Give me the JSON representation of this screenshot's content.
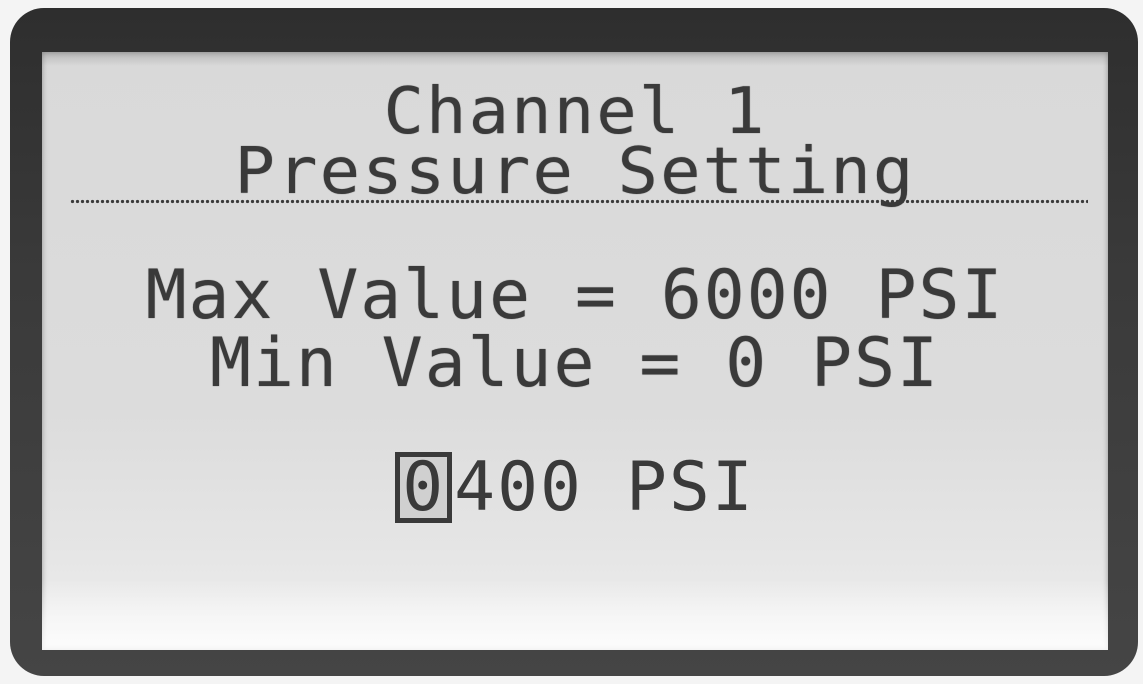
{
  "header": {
    "title": "Channel 1",
    "subtitle": "Pressure Setting"
  },
  "limits": {
    "max_text": "Max Value = 6000 PSI",
    "min_text": "Min Value = 0 PSI"
  },
  "setpoint": {
    "cursor_digit": "0",
    "value_rest": "400",
    "unit": "PSI"
  },
  "colors": {
    "lcd_background": "#d9d9d9",
    "lcd_text": "#3a3a3a",
    "bezel": "#3a3a3a"
  }
}
